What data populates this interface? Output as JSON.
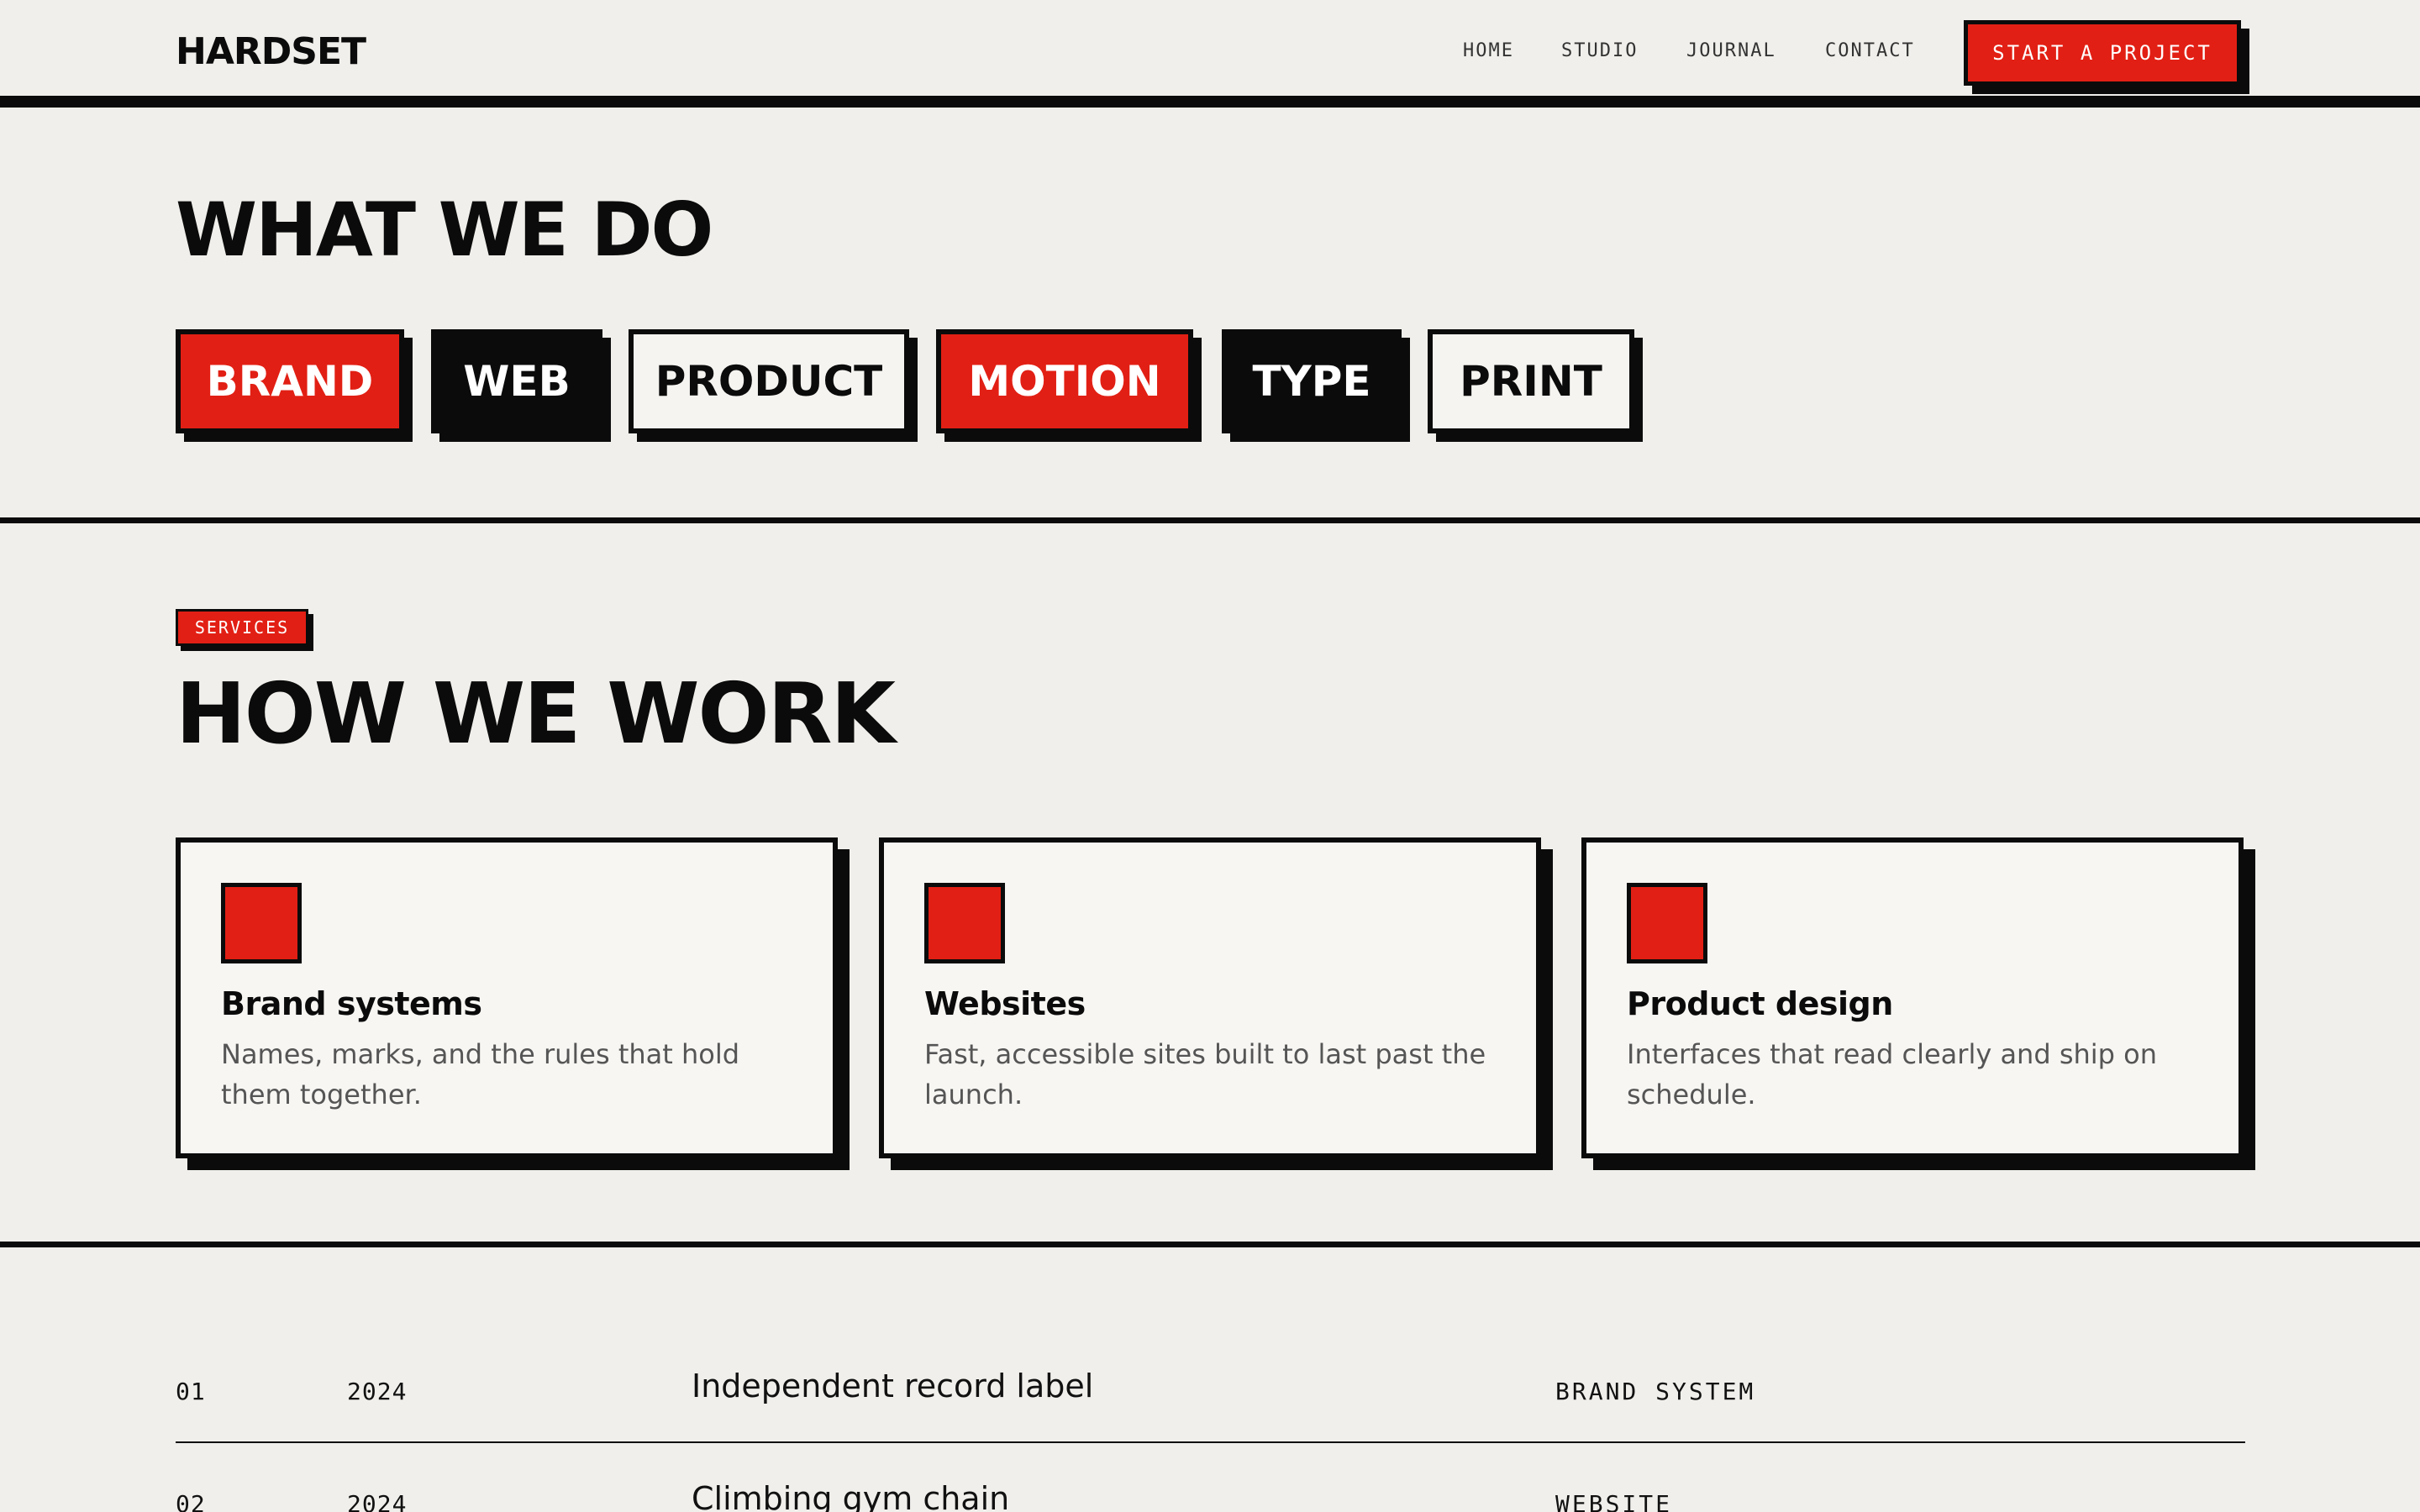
{
  "header": {
    "logo": "HARDSET",
    "nav": [
      "HOME",
      "STUDIO",
      "JOURNAL",
      "CONTACT"
    ],
    "cta": "START A PROJECT"
  },
  "what_we_do": {
    "title": "WHAT WE DO",
    "chips": [
      "BRAND",
      "WEB",
      "PRODUCT",
      "MOTION",
      "TYPE",
      "PRINT"
    ]
  },
  "services": {
    "tag": "SERVICES",
    "title": "HOW WE WORK",
    "cards": [
      {
        "title": "Brand systems",
        "desc": "Names, marks, and the rules that hold them together."
      },
      {
        "title": "Websites",
        "desc": "Fast, accessible sites built to last past the launch."
      },
      {
        "title": "Product design",
        "desc": "Interfaces that read clearly and ship on schedule."
      }
    ]
  },
  "projects": [
    {
      "num": "01",
      "year": "2024",
      "name": "Independent record label",
      "type": "BRAND SYSTEM"
    },
    {
      "num": "02",
      "year": "2024",
      "name": "Climbing gym chain",
      "type": "WEBSITE"
    }
  ],
  "colors": {
    "accent": "#e21f14",
    "ink": "#0b0b0b",
    "paper": "#f0efeb"
  }
}
